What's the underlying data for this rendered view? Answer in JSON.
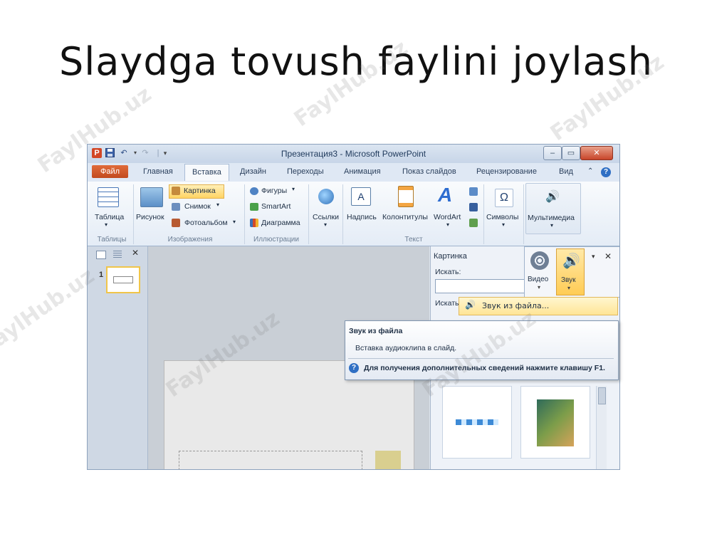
{
  "slide": {
    "title": "Slaydga tovush faylini joylash"
  },
  "watermark": "FaylHub.uz",
  "window": {
    "title": "Презентация3 - Microsoft PowerPoint",
    "undo_icon": "undo-icon",
    "close_symbol": "✕",
    "min_symbol": "–",
    "max_symbol": "▭"
  },
  "tabs": {
    "file": "Файл",
    "home": "Главная",
    "insert": "Вставка",
    "design": "Дизайн",
    "transitions": "Переходы",
    "animation": "Анимация",
    "slideshow": "Показ слайдов",
    "review": "Рецензирование",
    "view": "Вид"
  },
  "ribbon": {
    "table": "Таблица",
    "picture": "Рисунок",
    "clipart": "Картинка",
    "screenshot": "Снимок",
    "photoalbum": "Фотоальбом",
    "shapes": "Фигуры",
    "smartart": "SmartArt",
    "chart": "Диаграмма",
    "links": "Ссылки",
    "textbox": "Надпись",
    "headerfooter": "Колонтитулы",
    "wordart": "WordArt",
    "symbols": "Символы",
    "multimedia": "Мультимедиа",
    "groups": {
      "tables": "Таблицы",
      "images": "Изображения",
      "illustrations": "Иллюстрации",
      "text": "Текст"
    }
  },
  "thumbnail": {
    "number": "1"
  },
  "task_pane": {
    "title": "Картинка",
    "search_label": "Искать:",
    "search_label2": "Искать"
  },
  "dropdown": {
    "video": "Видео",
    "audio": "Звук"
  },
  "menu": {
    "audio_from_file": "Звук из файла..."
  },
  "tooltip": {
    "title": "Звук из файла",
    "description": "Вставка аудиоклипа в слайд.",
    "help": "Для получения дополнительных сведений нажмите клавишу F1."
  }
}
